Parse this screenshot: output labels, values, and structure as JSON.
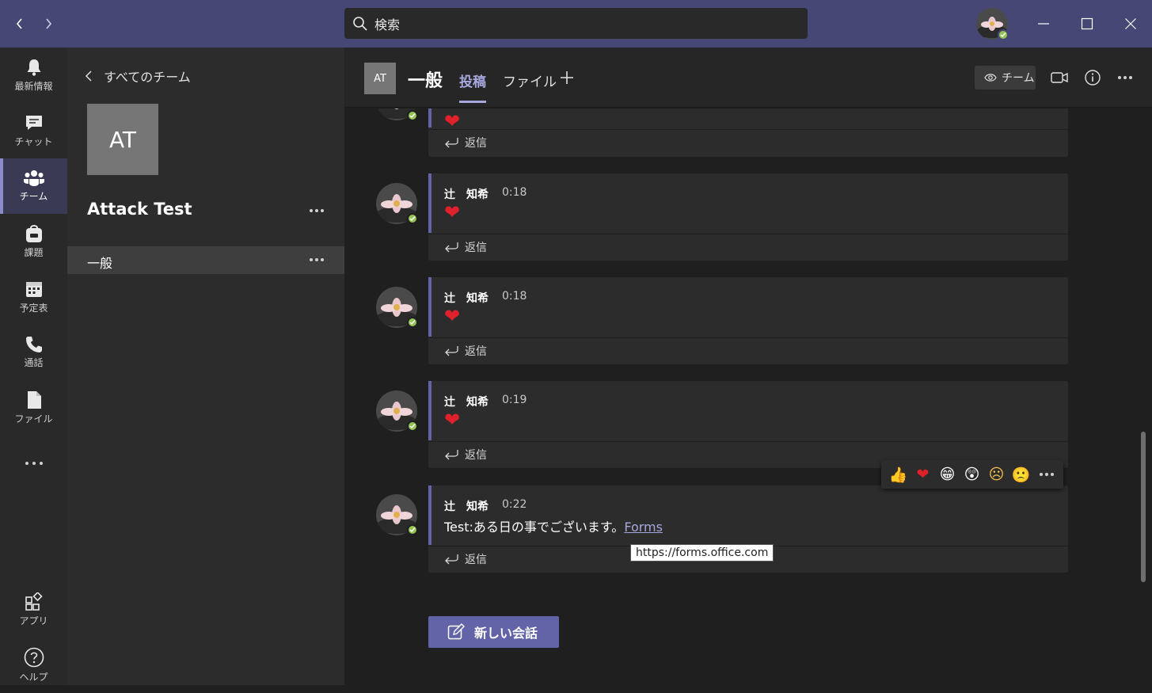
{
  "titlebar": {
    "search_text": "検索"
  },
  "rail": {
    "items": [
      {
        "label": "最新情報"
      },
      {
        "label": "チャット"
      },
      {
        "label": "チーム"
      },
      {
        "label": "課題"
      },
      {
        "label": "予定表"
      },
      {
        "label": "通話"
      },
      {
        "label": "ファイル"
      },
      {
        "label": "アプリ"
      },
      {
        "label": "ヘルプ"
      }
    ]
  },
  "teampanel": {
    "back_label": "すべてのチーム",
    "team_initials": "AT",
    "team_name": "Attack Test",
    "channels": [
      {
        "name": "一般"
      }
    ]
  },
  "channel": {
    "initials": "AT",
    "name": "一般",
    "tabs": [
      {
        "label": "投稿"
      },
      {
        "label": "ファイル"
      }
    ],
    "team_button": "チーム"
  },
  "posts": [
    {
      "author": "辻　知希",
      "time": "0:18",
      "reply": "返信"
    },
    {
      "author": "辻　知希",
      "time": "0:18",
      "reply": "返信"
    },
    {
      "author": "辻　知希",
      "time": "0:19",
      "reply": "返信"
    },
    {
      "author": "辻　知希",
      "time": "0:22",
      "text": "Test:ある日の事でございます。",
      "link_text": "Forms",
      "reply": "返信"
    }
  ],
  "top_partial_reply": "返信",
  "reactions": [
    "👍",
    "❤",
    "😁",
    "😲",
    "☹",
    "🙁"
  ],
  "tooltip": "https://forms.office.com",
  "new_conversation": "新しい会話",
  "colors": {
    "titlebar": "#464775",
    "accent": "#6264a7",
    "active_tab": "#a6a7dc",
    "presence": "#92c353",
    "heart": "#e0202a"
  }
}
